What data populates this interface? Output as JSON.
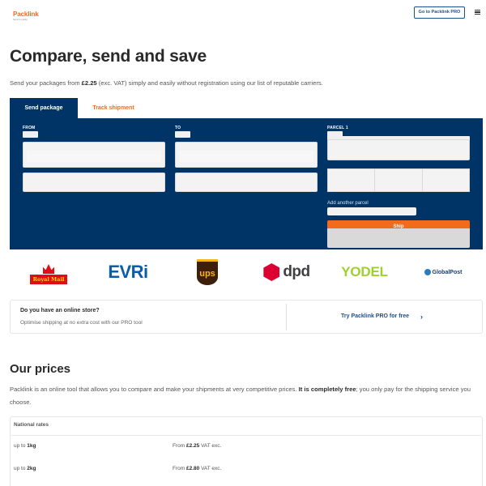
{
  "header": {
    "logo_main": "Packlink",
    "logo_sub": "Send it easily",
    "pro_button": "Go to Packlink PRO",
    "menu_icon": "hamburger-menu-icon"
  },
  "hero": {
    "title": "Compare, send and save",
    "sub_before": "Send your packages from ",
    "sub_price": "£2.25",
    "sub_after": " (exc. VAT) simply and easily without registration using our list of reputable carriers."
  },
  "tabs": [
    {
      "label": "Send package",
      "active": true
    },
    {
      "label": "Track shipment",
      "active": false
    }
  ],
  "form": {
    "from_label": "FROM",
    "to_label": "TO",
    "parcel_label": "PARCEL 1",
    "add_parcel": "Add another parcel",
    "ship_button": "Ship"
  },
  "carriers": [
    "Royal Mail",
    "EVRi",
    "ups",
    "dpd",
    "YODEL",
    "GlobalPost"
  ],
  "promo": {
    "title": "Do you have an online store?",
    "subtitle": "Optimise shipping at no extra cost with our PRO tool",
    "link": "Try Packlink PRO for free",
    "chevron": "›"
  },
  "prices": {
    "title": "Our prices",
    "desc_before": "Packlink is an online tool that allows you to compare and make your shipments at very competitive prices. ",
    "desc_bold": "It is completely free",
    "desc_after": "; you only pay for the shipping service you choose.",
    "table_header": "National rates",
    "rows": [
      {
        "prefix": "up to ",
        "weight": "1kg",
        "price_prefix": "From ",
        "price": "£2.25",
        "price_suffix": " VAT exc."
      },
      {
        "prefix": "up to ",
        "weight": "2kg",
        "price_prefix": "From ",
        "price": "£2.80",
        "price_suffix": " VAT exc."
      }
    ]
  },
  "colors": {
    "brand_orange": "#f26b1d",
    "navy": "#003366",
    "link_blue": "#1d4e8f"
  }
}
